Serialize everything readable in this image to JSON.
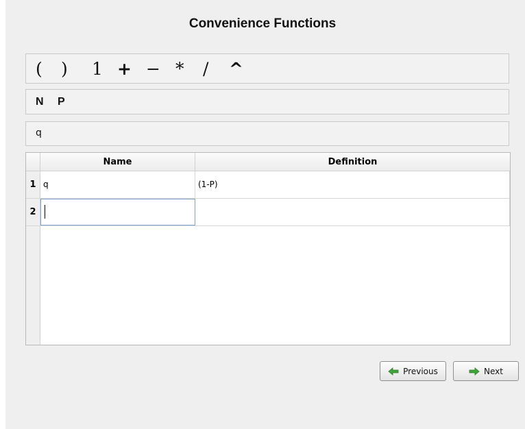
{
  "title": "Convenience Functions",
  "operators": {
    "lparen": "(",
    "rparen": ")",
    "one": "1",
    "plus": "+",
    "minus": "−",
    "times": "*",
    "divide": "/",
    "power": "^"
  },
  "variables": [
    "N",
    "P"
  ],
  "functions": [
    "q"
  ],
  "table": {
    "columns": [
      "Name",
      "Definition"
    ],
    "rows": [
      {
        "num": "1",
        "name": "q",
        "definition": "(1-P)"
      },
      {
        "num": "2",
        "name": "",
        "definition": ""
      }
    ]
  },
  "buttons": {
    "previous": "Previous",
    "next": "Next"
  },
  "colors": {
    "arrow_green": "#3fa43a"
  }
}
